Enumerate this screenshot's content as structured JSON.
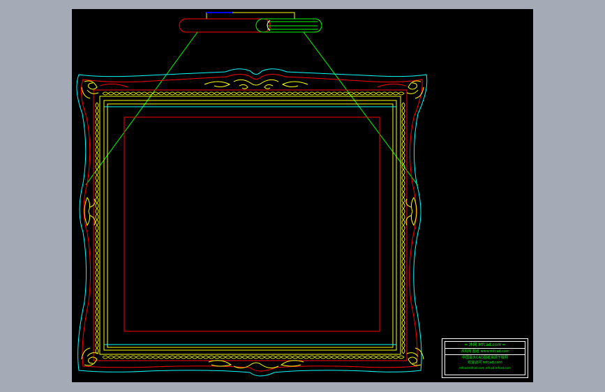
{
  "viewport": {
    "background": "#000000",
    "frame": "#a4abb6"
  },
  "colors": {
    "cyan": "#00ffff",
    "red": "#ff0000",
    "yellow": "#ffff00",
    "green": "#00ff00",
    "white": "#ffffff",
    "blue": "#0000ff"
  },
  "title_block": {
    "row1": "═ 沐风 Mfcad.com ═",
    "row2": "沐风网 图纸 www.mfcad.com",
    "row3": "中国最大CAD图纸资源下载网",
    "row4": "欢迎访问 mfcad.com",
    "row5": "mfcad-mfcad.com   mfcad-mfcad.com"
  }
}
